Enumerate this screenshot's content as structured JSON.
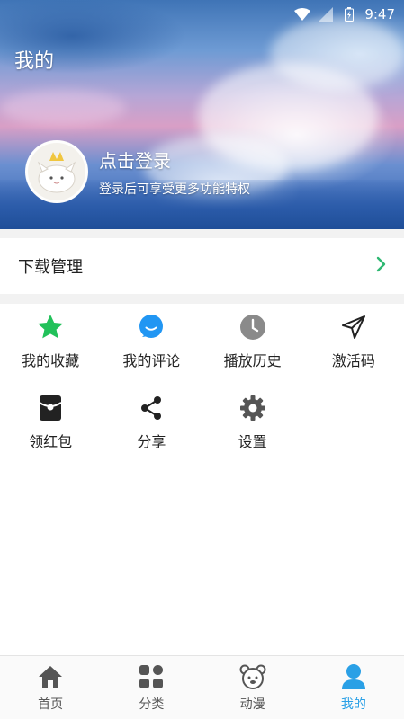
{
  "status_bar": {
    "time": "9:47"
  },
  "header": {
    "title": "我的"
  },
  "login": {
    "title": "点击登录",
    "subtitle": "登录后可享受更多功能特权"
  },
  "download": {
    "label": "下载管理"
  },
  "grid": [
    {
      "label": "我的收藏",
      "icon": "star-icon",
      "color": "#22c15a"
    },
    {
      "label": "我的评论",
      "icon": "comment-icon",
      "color": "#2196f3"
    },
    {
      "label": "播放历史",
      "icon": "clock-icon",
      "color": "#8a8a8a"
    },
    {
      "label": "激活码",
      "icon": "send-icon",
      "color": "#222222"
    },
    {
      "label": "领红包",
      "icon": "red-packet-icon",
      "color": "#222222"
    },
    {
      "label": "分享",
      "icon": "share-icon",
      "color": "#222222"
    },
    {
      "label": "设置",
      "icon": "gear-icon",
      "color": "#555555"
    }
  ],
  "nav": [
    {
      "label": "首页",
      "icon": "home-icon"
    },
    {
      "label": "分类",
      "icon": "category-icon"
    },
    {
      "label": "动漫",
      "icon": "bear-icon"
    },
    {
      "label": "我的",
      "icon": "user-icon",
      "active": true
    }
  ],
  "colors": {
    "accent": "#2aa0e6",
    "chevron": "#2eb872",
    "divider": "#f2f2f2"
  }
}
